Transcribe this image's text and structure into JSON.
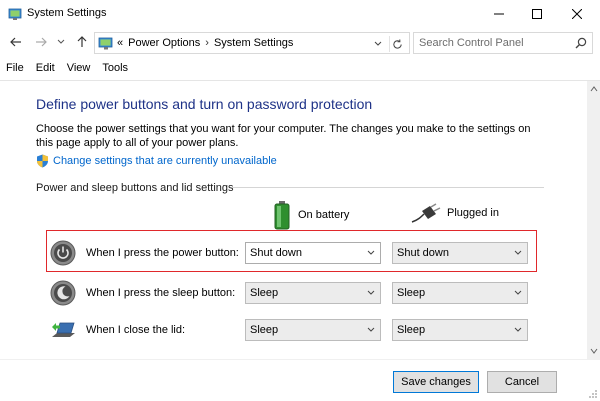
{
  "window": {
    "title": "System Settings",
    "icon": "control-panel-icon"
  },
  "address": {
    "overflow": "«",
    "crumbs": [
      "Power Options",
      "System Settings"
    ],
    "search_placeholder": "Search Control Panel"
  },
  "menu": [
    "File",
    "Edit",
    "View",
    "Tools"
  ],
  "main": {
    "heading": "Define power buttons and turn on password protection",
    "description": "Choose the power settings that you want for your computer. The changes you make to the settings on this page apply to all of your power plans.",
    "change_link": "Change settings that are currently unavailable",
    "section_title": "Power and sleep buttons and lid settings",
    "columns": {
      "battery": "On battery",
      "plugged": "Plugged in"
    },
    "rows": [
      {
        "label": "When I press the power button:",
        "battery": "Shut down",
        "plugged": "Shut down",
        "icon": "power-button-icon"
      },
      {
        "label": "When I press the sleep button:",
        "battery": "Sleep",
        "plugged": "Sleep",
        "icon": "sleep-button-icon"
      },
      {
        "label": "When I close the lid:",
        "battery": "Sleep",
        "plugged": "Sleep",
        "icon": "laptop-lid-icon"
      }
    ]
  },
  "footer": {
    "save_label": "Save changes",
    "cancel_label": "Cancel"
  },
  "colors": {
    "heading": "#1e3287",
    "link": "#0066cc",
    "highlight_border": "#e0282b",
    "primary_border": "#0078d7"
  }
}
